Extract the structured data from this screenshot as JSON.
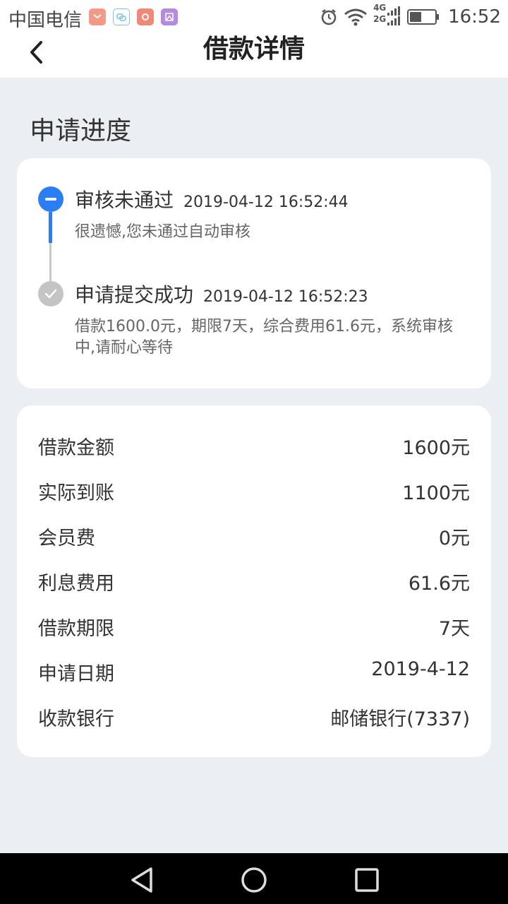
{
  "status_bar": {
    "carrier": "中国电信",
    "time": "16:52",
    "network_label_top": "4G",
    "network_label_bottom": "2G",
    "notif_colors": [
      "#f08a78",
      "#7fc2e8",
      "#f08a78",
      "#b58ae0"
    ]
  },
  "nav": {
    "title": "借款详情",
    "back_icon": "chevron-left-icon"
  },
  "progress": {
    "section_title": "申请进度",
    "steps": [
      {
        "title": "审核未通过",
        "time": "2019-04-12 16:52:44",
        "description": "很遗憾,您未通过自动审核",
        "status": "rejected",
        "icon": "minus-circle-icon",
        "color": "#2a7df2"
      },
      {
        "title": "申请提交成功",
        "time": "2019-04-12 16:52:23",
        "description": "借款1600.0元，期限7天，综合费用61.6元，系统审核中,请耐心等待",
        "status": "done",
        "icon": "check-circle-icon",
        "color": "#c4c4c4"
      }
    ]
  },
  "details": {
    "rows": [
      {
        "label": "借款金额",
        "value": "1600元"
      },
      {
        "label": "实际到账",
        "value": "1100元"
      },
      {
        "label": "会员费",
        "value": "0元"
      },
      {
        "label": "利息费用",
        "value": "61.6元"
      },
      {
        "label": "借款期限",
        "value": "7天"
      },
      {
        "label": "申请日期",
        "value": "2019-4-12"
      },
      {
        "label": "收款银行",
        "value": "邮储银行(7337)"
      }
    ]
  },
  "system_nav": {
    "buttons": [
      "back-triangle-icon",
      "home-circle-icon",
      "recents-square-icon"
    ]
  }
}
